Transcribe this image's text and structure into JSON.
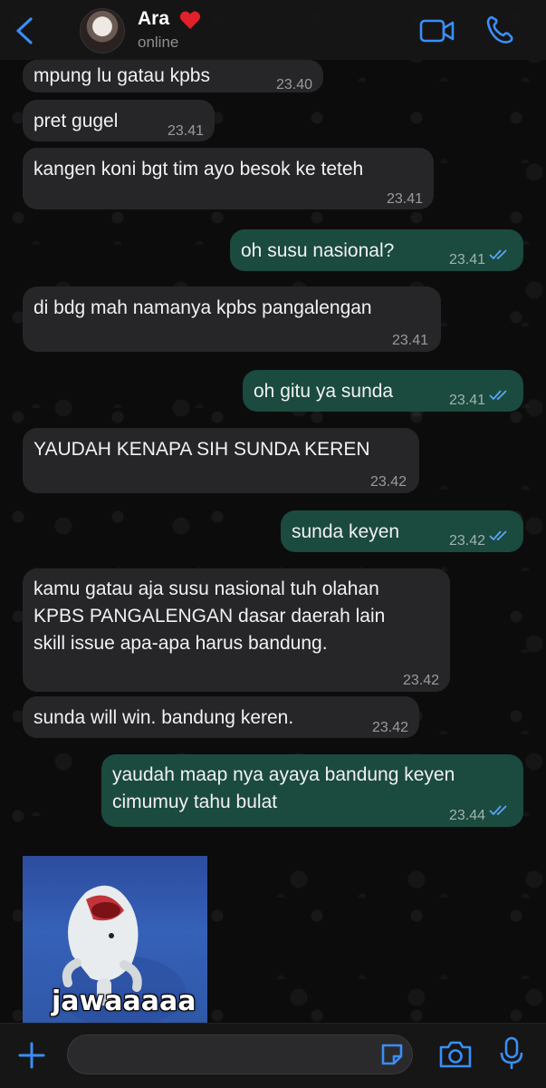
{
  "header": {
    "contact_name": "Ara",
    "status": "online",
    "heart_emoji": "red-heart",
    "icons": [
      "chevron-left-icon",
      "video-camera-icon",
      "phone-icon"
    ]
  },
  "colors": {
    "accent": "#3a8ef6",
    "incoming_bubble": "#262628",
    "outgoing_bubble": "#1b4a3f",
    "read_ticks": "#5aa5f5"
  },
  "messages": [
    {
      "direction": "in",
      "text": "mpung lu gatau kpbs",
      "time": "23.40"
    },
    {
      "direction": "in",
      "text": "pret gugel",
      "time": "23.41"
    },
    {
      "direction": "in",
      "text": "kangen koni bgt tim ayo besok ke teteh",
      "time": "23.41"
    },
    {
      "direction": "out",
      "text": "oh susu nasional?",
      "time": "23.41",
      "read": true
    },
    {
      "direction": "in",
      "text": "di bdg mah namanya kpbs pangalengan",
      "time": "23.41"
    },
    {
      "direction": "out",
      "text": "oh gitu ya sunda",
      "time": "23.41",
      "read": true
    },
    {
      "direction": "in",
      "text": "YAUDAH KENAPA SIH SUNDA KEREN",
      "time": "23.42"
    },
    {
      "direction": "out",
      "text": "sunda keyen",
      "time": "23.42",
      "read": true
    },
    {
      "direction": "in",
      "lines": [
        "kamu gatau aja susu nasional tuh olahan",
        "KPBS PANGALENGAN dasar daerah lain",
        "skill issue apa-apa harus bandung."
      ],
      "time": "23.42"
    },
    {
      "direction": "in",
      "text": "sunda will win. bandung keren.",
      "time": "23.42"
    },
    {
      "direction": "out",
      "lines": [
        "yaudah maap nya ayaya bandung keyen",
        "cimumuy tahu bulat"
      ],
      "time": "23.44",
      "read": true
    }
  ],
  "sticker": {
    "caption": "jawaaaaa"
  },
  "footer": {
    "input_value": "",
    "icons": [
      "plus-icon",
      "sticker-icon",
      "camera-icon",
      "microphone-icon"
    ]
  }
}
